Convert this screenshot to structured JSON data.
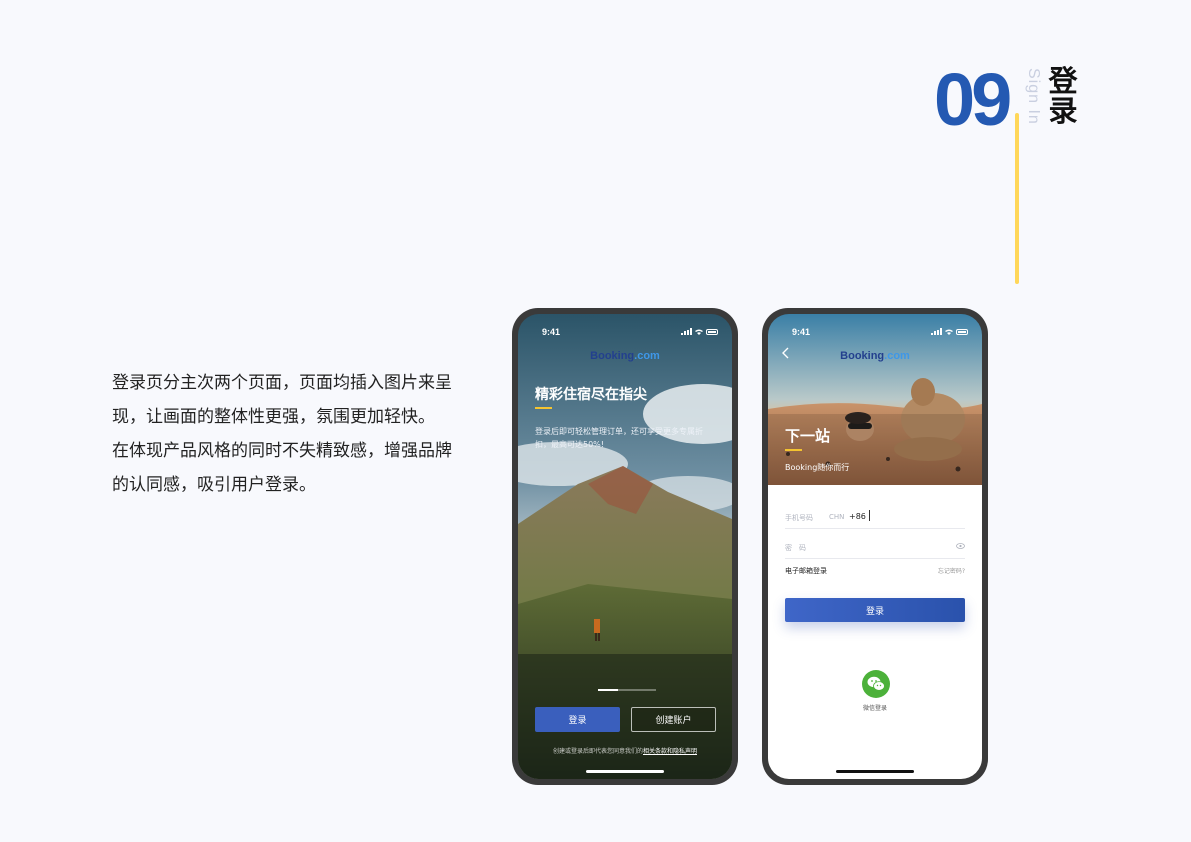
{
  "header": {
    "section_number": "09",
    "section_en": "Sign In",
    "section_cn_1": "登",
    "section_cn_2": "录"
  },
  "description": {
    "para1": "登录页分主次两个页面，页面均插入图片来呈现，让画面的整体性更强，氛围更加轻快。",
    "para2": "在体现产品风格的同时不失精致感，增强品牌的认同感，吸引用户登录。"
  },
  "phone1": {
    "time": "9:41",
    "logo_a": "Booking",
    "logo_b": ".com",
    "title": "精彩住宿尽在指尖",
    "subtitle": "登录后即可轻松管理订单，还可享受更多专属折扣，最高可达50%!",
    "login_label": "登录",
    "create_label": "创建账户",
    "terms_prefix": "创建或登录后即代表您同意我们的",
    "terms_link": "相关条款和隐私声明"
  },
  "phone2": {
    "time": "9:41",
    "logo_a": "Booking",
    "logo_b": ".com",
    "title": "下一站",
    "subtitle": "Booking随你而行",
    "phone_label": "手机号码",
    "country": "CHN",
    "code": "+86",
    "pwd_label": "密　码",
    "email_login": "电子邮箱登录",
    "forgot": "忘记密码?",
    "login_label": "登录",
    "wechat_label": "微信登录"
  },
  "icons": {
    "eye": "eye-icon",
    "back": "chevron-left-icon",
    "wechat": "wechat-icon"
  },
  "colors": {
    "brand_blue": "#2459b2",
    "accent_yellow": "#ffd75a",
    "button_blue": "#3a5fbd",
    "wechat_green": "#4cb13a"
  }
}
